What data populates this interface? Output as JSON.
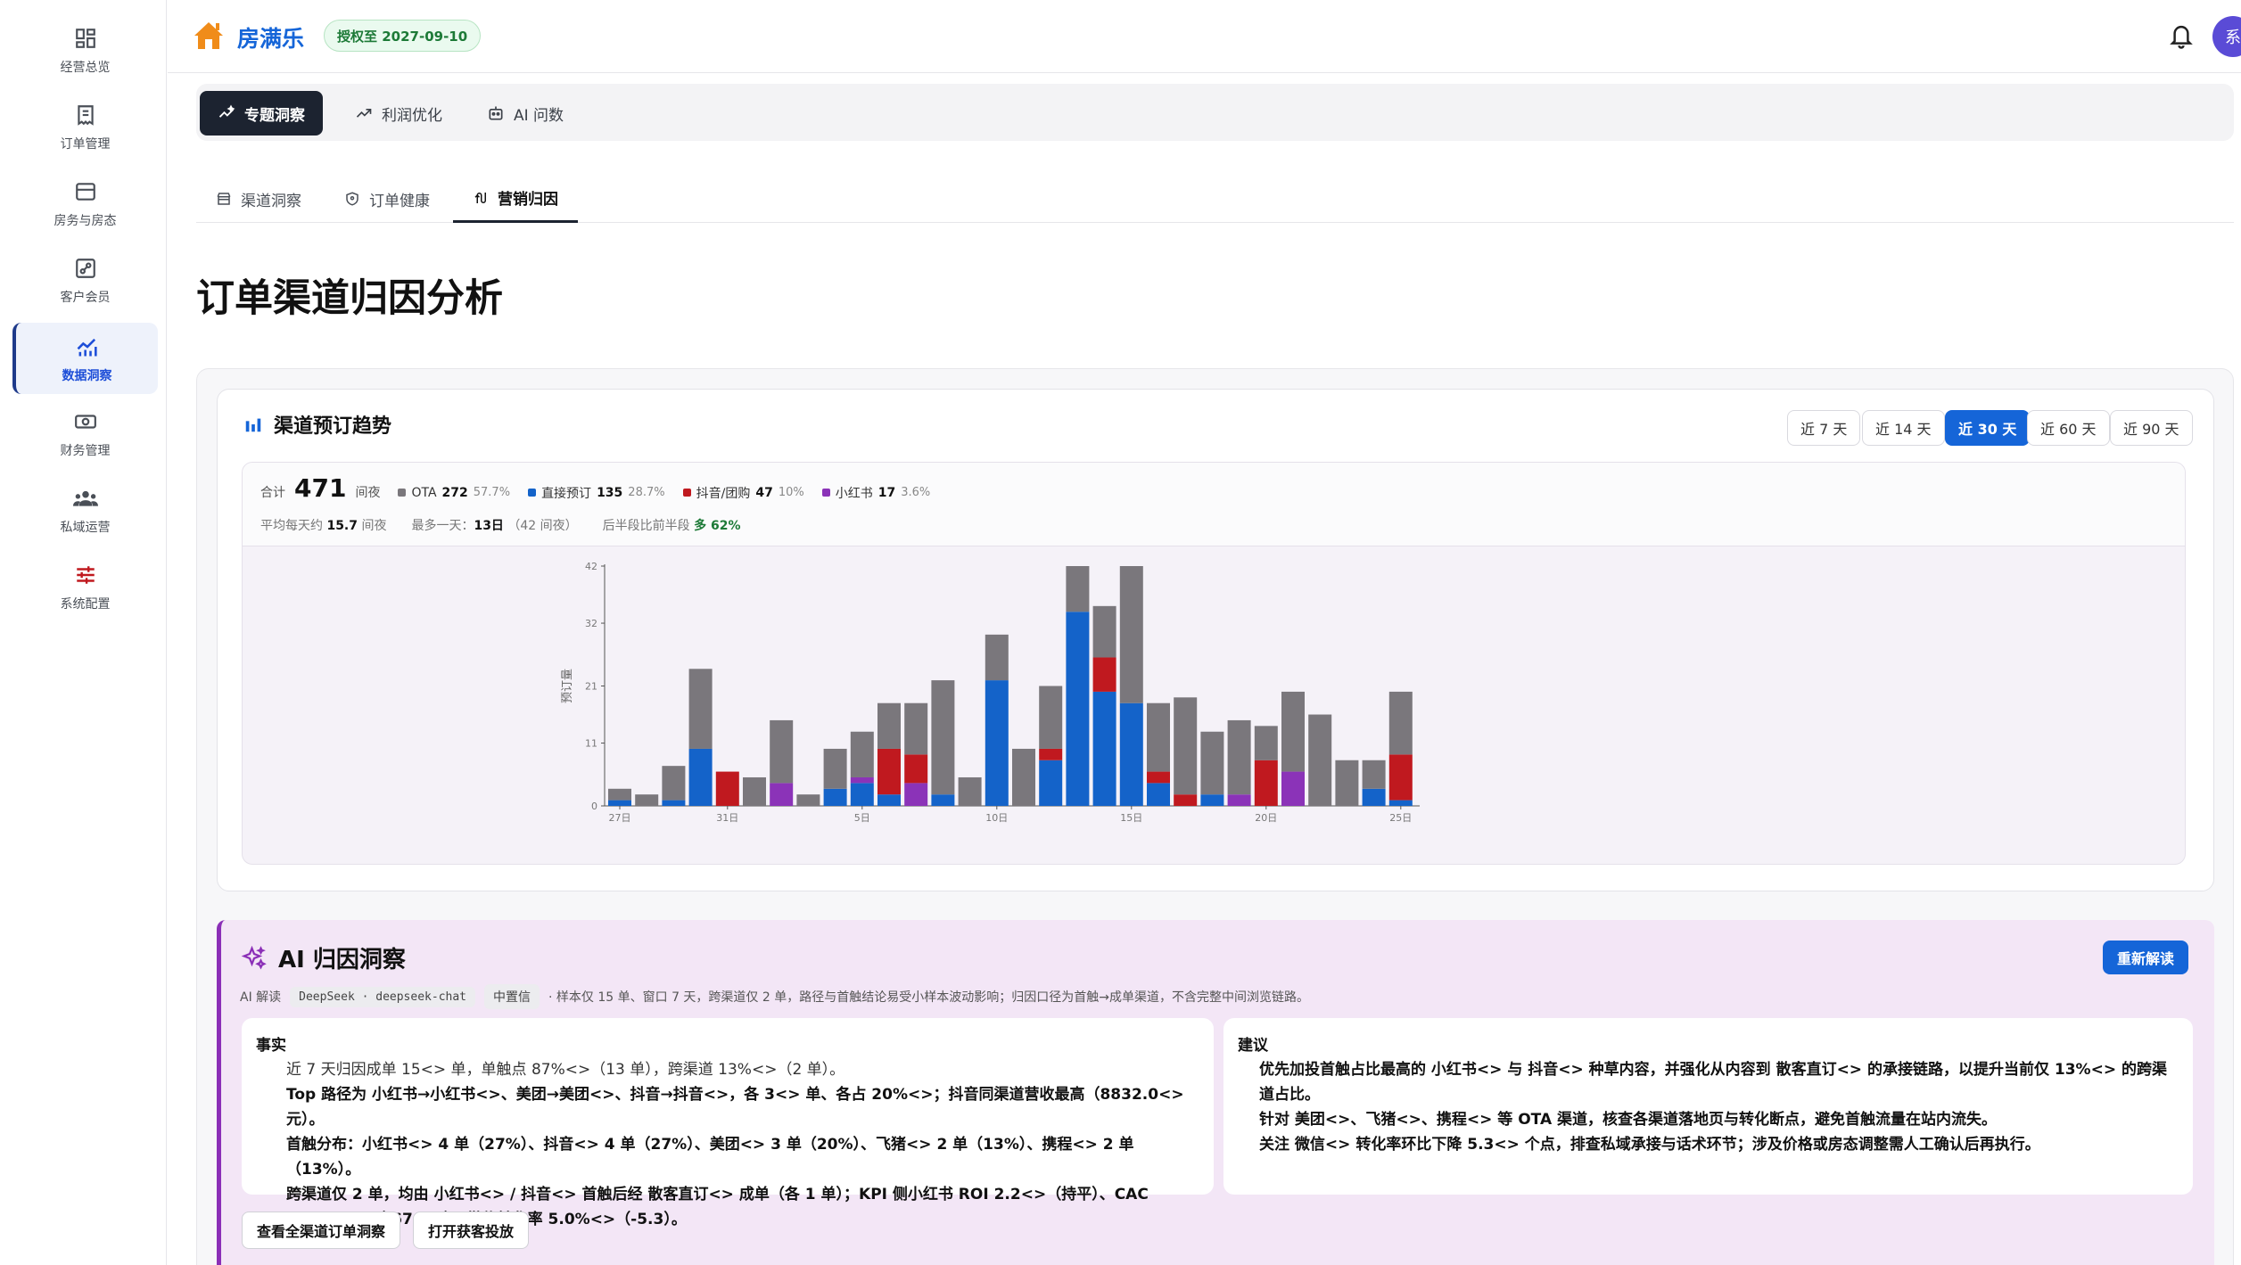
{
  "app": {
    "brand": "房满乐",
    "license": "授权至 2027-09-10",
    "avatar_text": "系"
  },
  "sidebar": {
    "items": [
      {
        "label": "经营总览",
        "icon": "dashboard-icon"
      },
      {
        "label": "订单管理",
        "icon": "order-icon"
      },
      {
        "label": "房务与房态",
        "icon": "room-icon"
      },
      {
        "label": "客户会员",
        "icon": "member-icon"
      },
      {
        "label": "数据洞察",
        "icon": "chart-icon",
        "active": true
      },
      {
        "label": "财务管理",
        "icon": "finance-icon"
      },
      {
        "label": "私域运营",
        "icon": "users-icon"
      },
      {
        "label": "系统配置",
        "icon": "settings-icon"
      }
    ]
  },
  "top_tabs": [
    {
      "label": "专题洞察",
      "active": true
    },
    {
      "label": "利润优化"
    },
    {
      "label": "AI 问数"
    }
  ],
  "sub_tabs": [
    {
      "label": "渠道洞察"
    },
    {
      "label": "订单健康"
    },
    {
      "label": "营销归因",
      "active": true
    }
  ],
  "page_title": "订单渠道归因分析",
  "trend_card": {
    "title": "渠道预订趋势",
    "ranges": [
      "近 7 天",
      "近 14 天",
      "近 30 天",
      "近 60 天",
      "近 90 天"
    ],
    "active_range": "近 30 天",
    "summary": {
      "total_label": "合计",
      "total_value": "471",
      "total_unit": "间夜",
      "legend": [
        {
          "name": "OTA",
          "value": "272",
          "pct": "57.7%",
          "color": "#7a777c"
        },
        {
          "name": "直接预订",
          "value": "135",
          "pct": "28.7%",
          "color": "#1463c9"
        },
        {
          "name": "抖音/团购",
          "value": "47",
          "pct": "10%",
          "color": "#c0191f"
        },
        {
          "name": "小红书",
          "value": "17",
          "pct": "3.6%",
          "color": "#8b33b8"
        }
      ],
      "avg_label": "平均每天约",
      "avg_value": "15.7",
      "avg_unit": "间夜",
      "peak_label": "最多一天：",
      "peak_value": "13日",
      "peak_note": "（42 间夜）",
      "half_label": "后半段比前半段",
      "half_value": "多 62%"
    }
  },
  "chart_data": {
    "type": "bar",
    "stacked": true,
    "ylabel": "预订量",
    "yticks": [
      0,
      11,
      21,
      32,
      42
    ],
    "ylim": [
      0,
      42
    ],
    "xtick_labels": [
      "27日",
      "31日",
      "5日",
      "10日",
      "15日",
      "20日",
      "25日"
    ],
    "xtick_index": [
      0,
      4,
      9,
      14,
      19,
      24,
      29
    ],
    "colors": {
      "OTA": "#7a777c",
      "直接预订": "#1463c9",
      "抖音/团购": "#c0191f",
      "小红书": "#8b33b8"
    },
    "series": [
      {
        "name": "直接预订",
        "values": [
          1,
          0,
          1,
          10,
          0,
          0,
          0,
          0,
          3,
          4,
          2,
          0,
          2,
          0,
          22,
          0,
          8,
          34,
          20,
          18,
          4,
          0,
          2,
          0,
          0,
          0,
          0,
          0,
          3,
          1
        ]
      },
      {
        "name": "小红书",
        "values": [
          0,
          0,
          0,
          0,
          0,
          0,
          4,
          0,
          0,
          1,
          0,
          4,
          0,
          0,
          0,
          0,
          0,
          0,
          0,
          0,
          0,
          0,
          0,
          2,
          0,
          6,
          0,
          0,
          0,
          0
        ]
      },
      {
        "name": "抖音/团购",
        "values": [
          0,
          0,
          0,
          0,
          6,
          0,
          0,
          0,
          0,
          0,
          8,
          5,
          0,
          0,
          0,
          0,
          2,
          0,
          6,
          0,
          2,
          2,
          0,
          0,
          8,
          0,
          0,
          0,
          0,
          8
        ]
      },
      {
        "name": "OTA",
        "values": [
          2,
          2,
          6,
          14,
          0,
          5,
          11,
          2,
          7,
          8,
          8,
          9,
          20,
          5,
          8,
          10,
          11,
          8,
          9,
          24,
          12,
          17,
          11,
          13,
          6,
          14,
          16,
          8,
          5,
          11
        ]
      }
    ]
  },
  "ai": {
    "title": "AI 归因洞察",
    "refresh_label": "重新解读",
    "meta_prefix": "AI 解读",
    "model_chip": "DeepSeek · deepseek-chat",
    "confidence_chip": "中置信",
    "meta_note": "· 样本仅 15 单、窗口 7 天，跨渠道仅 2 单，路径与首触结论易受小样本波动影响；归因口径为首触→成单渠道，不含完整中间浏览链路。",
    "facts_title": "事实",
    "facts": [
      "近 7 天归因成单 15<> 单，单触点 87%<>（13 单），跨渠道 13%<>（2 单）。",
      "Top 路径为 小红书→小红书<>、美团→美团<>、抖音→抖音<>，各 3<> 单、各占 20%<>；抖音同渠道营收最高（8832.0<> 元）。",
      "首触分布：小红书<> 4 单（27%）、抖音<> 4 单（27%）、美团<> 3 单（20%）、飞猪<> 2 单（13%）、携程<> 2 单（13%）。",
      "跨渠道仅 2 单，均由 小红书<> / 抖音<> 首触后经 散客直订<> 成单（各 1 单）；KPI 侧小红书 ROI 2.2<>（持平）、CAC 131.22<>（-67.5%）、微信转化率 5.0%<>（-5.3）。"
    ],
    "suggest_title": "建议",
    "suggestions": [
      "优先加投首触占比最高的 小红书<> 与 抖音<> 种草内容，并强化从内容到 散客直订<> 的承接链路，以提升当前仅 13%<> 的跨渠道占比。",
      "针对 美团<>、飞猪<>、携程<> 等 OTA 渠道，核查各渠道落地页与转化断点，避免首触流量在站内流失。",
      "关注 微信<> 转化率环比下降 5.3<> 个点，排查私域承接与话术环节；涉及价格或房态调整需人工确认后再执行。"
    ],
    "action1": "查看全渠道订单洞察",
    "action2": "打开获客投放"
  }
}
